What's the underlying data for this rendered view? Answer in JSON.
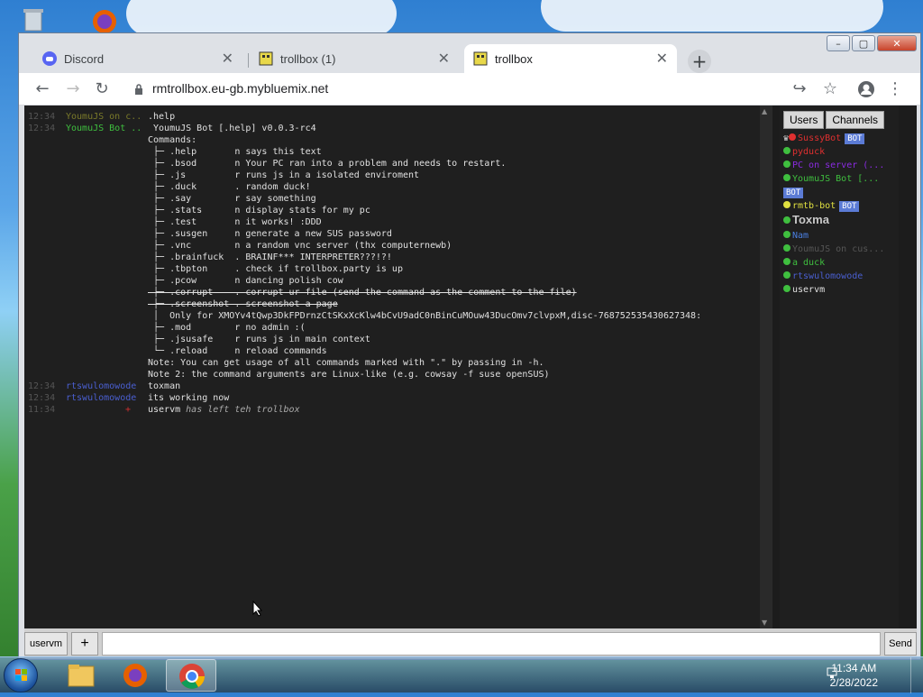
{
  "browser": {
    "tabs": [
      {
        "title": "Discord",
        "favicon": "discord-icon"
      },
      {
        "title": "trollbox (1)",
        "favicon": "trollbox-icon"
      },
      {
        "title": "trollbox",
        "favicon": "trollbox-icon",
        "active": true
      }
    ],
    "url": "rmtrollbox.eu-gb.mybluemix.net"
  },
  "chat": {
    "messages": [
      {
        "time": "12:34",
        "nick": "YoumuJS on c...",
        "nick_color": "#7a7a2a",
        "text": ".help"
      },
      {
        "time": "12:34",
        "nick": "YoumuJS Bot ...",
        "nick_color": "#3fbf3f",
        "text": " YoumuJS Bot [.help] v0.0.3-rc4"
      },
      {
        "time": "",
        "nick": "",
        "nick_color": "",
        "text": "Commands:"
      },
      {
        "time": "",
        "nick": "",
        "nick_color": "",
        "text": " ├─ .help       n says this text"
      },
      {
        "time": "",
        "nick": "",
        "nick_color": "",
        "text": " ├─ .bsod       n Your PC ran into a problem and needs to restart."
      },
      {
        "time": "",
        "nick": "",
        "nick_color": "",
        "text": " ├─ .js         r runs js in a isolated enviroment"
      },
      {
        "time": "",
        "nick": "",
        "nick_color": "",
        "text": " ├─ .duck       . random duck!"
      },
      {
        "time": "",
        "nick": "",
        "nick_color": "",
        "text": " ├─ .say        r say something"
      },
      {
        "time": "",
        "nick": "",
        "nick_color": "",
        "text": " ├─ .stats      n display stats for my pc"
      },
      {
        "time": "",
        "nick": "",
        "nick_color": "",
        "text": " ├─ .test       n it works! :DDD"
      },
      {
        "time": "",
        "nick": "",
        "nick_color": "",
        "text": " ├─ .susgen     n generate a new SUS password"
      },
      {
        "time": "",
        "nick": "",
        "nick_color": "",
        "text": " ├─ .vnc        n a random vnc server (thx computernewb)"
      },
      {
        "time": "",
        "nick": "",
        "nick_color": "",
        "text": " ├─ .brainfuck  . BRAINF*** INTERPRETER???!?!"
      },
      {
        "time": "",
        "nick": "",
        "nick_color": "",
        "text": " ├─ .tbpton     . check if trollbox.party is up"
      },
      {
        "time": "",
        "nick": "",
        "nick_color": "",
        "text": " ├─ .pcow       n dancing polish cow"
      },
      {
        "time": "",
        "nick": "",
        "nick_color": "",
        "text": " ├─ .corrupt    . corrupt ur file (send the command as the comment to the file)",
        "strike": true
      },
      {
        "time": "",
        "nick": "",
        "nick_color": "",
        "text": " ├─ .screenshot . screenshot a page",
        "strike": true
      },
      {
        "time": "",
        "nick": "",
        "nick_color": "",
        "text": " │  Only for XMOYv4tQwp3DkFPDrnzCtSKxXcKlw4bCvU9adC0nBinCuMOuw43DucOmv7clvpxM,disc-768752535430627348:"
      },
      {
        "time": "",
        "nick": "",
        "nick_color": "",
        "text": " ├─ .mod        r no admin :("
      },
      {
        "time": "",
        "nick": "",
        "nick_color": "",
        "text": " ├─ .jsusafe    r runs js in main context"
      },
      {
        "time": "",
        "nick": "",
        "nick_color": "",
        "text": " └─ .reload     n reload commands"
      },
      {
        "time": "",
        "nick": "",
        "nick_color": "",
        "text": "Note: You can get usage of all commands marked with \".\" by passing in -h."
      },
      {
        "time": "",
        "nick": "",
        "nick_color": "",
        "text": "Note 2: the command arguments are Linux-like (e.g. cowsay -f suse openSUS)"
      },
      {
        "time": "12:34",
        "nick": "rtswulomowode",
        "nick_color": "#4a5fd0",
        "text": "toxman"
      },
      {
        "time": "12:34",
        "nick": "rtswulomowode",
        "nick_color": "#4a5fd0",
        "text": "its working now"
      },
      {
        "time": "11:34",
        "nick": "+",
        "nick_color": "#d03030",
        "text": "uservm ",
        "italic": "has left teh trollbox"
      }
    ]
  },
  "users_panel": {
    "tabs": [
      "Users",
      "Channels"
    ],
    "users": [
      {
        "name": "SussyBot",
        "color": "#e03030",
        "dot": "#e03030",
        "bot": true,
        "prefix": "♛"
      },
      {
        "name": "pyduck",
        "color": "#e03030",
        "dot": "#3fbf3f"
      },
      {
        "name": "PC on server (...",
        "color": "#8a2be2",
        "dot": "#3fbf3f"
      },
      {
        "name": "YoumuJS Bot [...",
        "color": "#3fbf3f",
        "dot": "#3fbf3f",
        "bot_below": true
      },
      {
        "name": "rmtb-bot",
        "color": "#e0e040",
        "dot": "#e0e040",
        "bot": true
      },
      {
        "name": "Toxma",
        "color": "#c8c8c8",
        "dot": "#3fbf3f",
        "large": true
      },
      {
        "name": "Nam",
        "color": "#4a7fe0",
        "dot": "#3fbf3f"
      },
      {
        "name": "YoumuJS on cus...",
        "color": "#555555",
        "dot": "#3fbf3f"
      },
      {
        "name": "a duck",
        "color": "#3fbf3f",
        "dot": "#3fbf3f"
      },
      {
        "name": "rtswulomowode",
        "color": "#4a5fd0",
        "dot": "#3fbf3f"
      },
      {
        "name": "uservm",
        "color": "#e0e0e0",
        "dot": "#3fbf3f"
      }
    ],
    "bot_badge": "BOT"
  },
  "input_bar": {
    "nick": "uservm",
    "plus": "+",
    "send": "Send"
  },
  "taskbar": {
    "time": "11:34 AM",
    "date": "2/28/2022"
  }
}
